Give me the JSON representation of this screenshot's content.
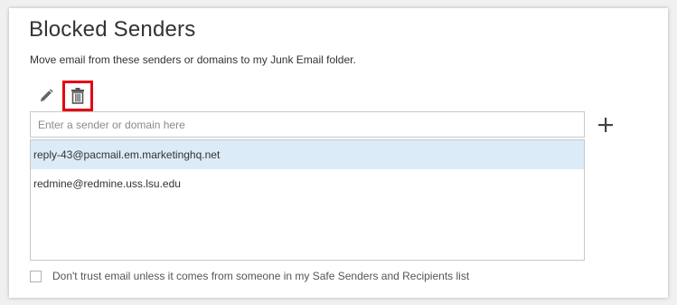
{
  "section": {
    "title": "Blocked Senders",
    "description": "Move email from these senders or domains to my Junk Email folder."
  },
  "toolbar": {
    "edit_icon": "pencil-icon",
    "delete_icon": "trash-icon",
    "highlight_color": "#e30613"
  },
  "input": {
    "placeholder": "Enter a sender or domain here",
    "value": ""
  },
  "add_button": {
    "icon": "plus-icon"
  },
  "list": {
    "items": [
      {
        "label": "reply-43@pacmail.em.marketinghq.net",
        "selected": true
      },
      {
        "label": "redmine@redmine.uss.lsu.edu",
        "selected": false
      }
    ]
  },
  "trust_option": {
    "label": "Don't trust email unless it comes from someone in my Safe Senders and Recipients list",
    "checked": false
  },
  "colors": {
    "selected_row": "#dcebf8",
    "border": "#c8c8c8",
    "text": "#333333"
  }
}
